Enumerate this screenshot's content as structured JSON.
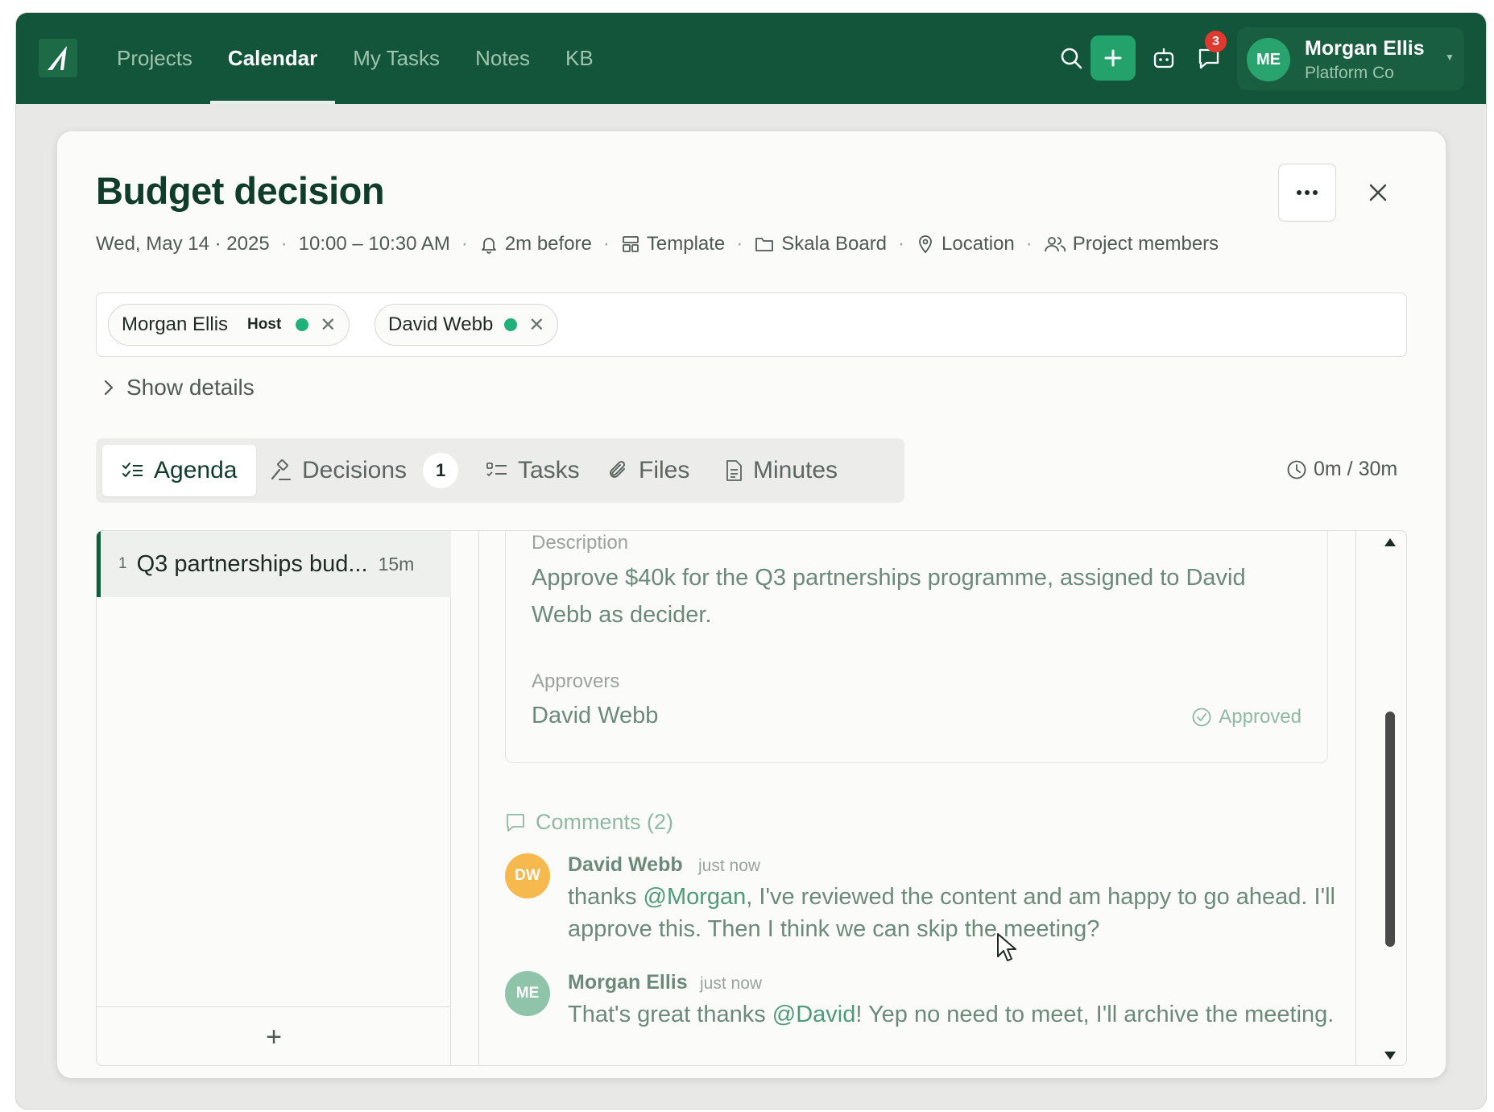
{
  "nav": {
    "items": [
      "Projects",
      "Calendar",
      "My Tasks",
      "Notes",
      "KB"
    ],
    "active": "Calendar"
  },
  "toolbar": {
    "notification_count": "3"
  },
  "user": {
    "initials": "ME",
    "name": "Morgan Ellis",
    "org": "Platform Co"
  },
  "meeting": {
    "title": "Budget decision",
    "date": "Wed, May 14 · 2025",
    "time": "10:00 – 10:30 AM",
    "reminder": "2m before",
    "template": "Template",
    "board": "Skala Board",
    "location": "Location",
    "members": "Project members",
    "show_details": "Show details"
  },
  "attendees": [
    {
      "name": "Morgan Ellis",
      "role": "Host"
    },
    {
      "name": "David Webb",
      "role": ""
    }
  ],
  "tabs": [
    {
      "label": "Agenda"
    },
    {
      "label": "Decisions",
      "count": "1"
    },
    {
      "label": "Tasks"
    },
    {
      "label": "Files"
    },
    {
      "label": "Minutes"
    }
  ],
  "timer": "0m / 30m",
  "agenda": {
    "items": [
      {
        "num": "1",
        "title": "Q3 partnerships bud...",
        "duration": "15m"
      }
    ],
    "add_label": "+"
  },
  "decision": {
    "description_label": "Description",
    "description": "Approve $40k for the Q3 partnerships programme, assigned to David Webb as decider.",
    "approvers_label": "Approvers",
    "approver": "David Webb",
    "status": "Approved"
  },
  "comments": {
    "header": "Comments (2)",
    "items": [
      {
        "initials": "DW",
        "author": "David Webb",
        "time": "just now",
        "text_before": "thanks ",
        "mention": "@Morgan",
        "text_after": ", I've reviewed the content and am happy to go ahead. I'll approve this. Then I think we can skip the meeting?",
        "avatar_color": "#f5b94e"
      },
      {
        "initials": "ME",
        "author": "Morgan Ellis",
        "time": "just now",
        "text_before": "That's great thanks ",
        "mention": "@David",
        "text_after": "! Yep no need to meet, I'll archive the meeting.",
        "avatar_color": "#8fc4aa"
      }
    ]
  },
  "colors": {
    "brand": "#13553a",
    "accent": "#24a26b",
    "online": "#20b07a",
    "badge": "#e0392f"
  }
}
